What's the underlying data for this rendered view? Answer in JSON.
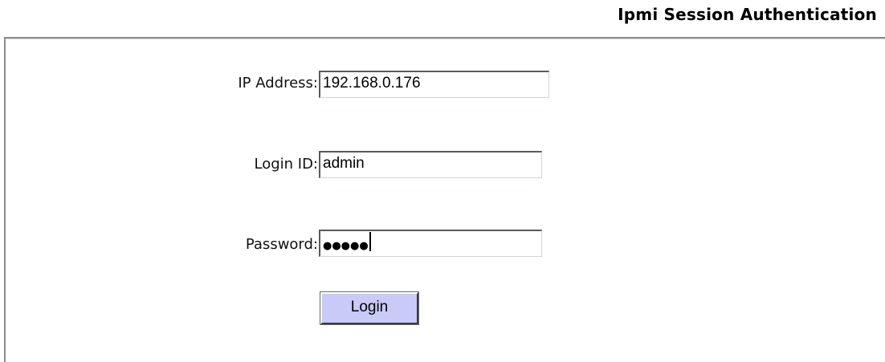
{
  "page": {
    "title": "Ipmi Session Authentication"
  },
  "form": {
    "ip_address": {
      "label": "IP Address:",
      "value": "192.168.0.176"
    },
    "login_id": {
      "label": "Login ID:",
      "value": "admin"
    },
    "password": {
      "label": "Password:",
      "masked_value": "●●●●●"
    },
    "login_button_label": "Login"
  }
}
